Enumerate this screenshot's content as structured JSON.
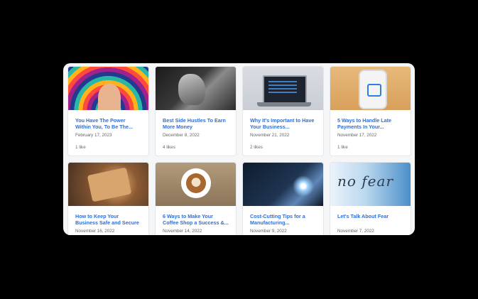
{
  "posts": [
    {
      "title": "You Have The Power Within You, To Be The...",
      "date": "February 17, 2023",
      "likes": "1 like",
      "image": "colorful-face-art"
    },
    {
      "title": "Best Side Hustles To Earn More Money",
      "date": "December 8, 2022",
      "likes": "4 likes",
      "image": "hand-bw"
    },
    {
      "title": "Why It's Important to Have Your Business...",
      "date": "November 21, 2022",
      "likes": "2 likes",
      "image": "laptop"
    },
    {
      "title": "5 Ways to Handle Late Payments In Your...",
      "date": "November 17, 2022",
      "likes": "1 like",
      "image": "payment-terminal"
    },
    {
      "title": "How to Keep Your Business Safe and Secure",
      "date": "November 16, 2022",
      "likes": "",
      "image": "team-table"
    },
    {
      "title": "6 Ways to Make Your Coffee Shop a Success &...",
      "date": "November 14, 2022",
      "likes": "",
      "image": "coffee-cup"
    },
    {
      "title": "Cost-Cutting Tips for a Manufacturing...",
      "date": "November 9, 2022",
      "likes": "",
      "image": "welding"
    },
    {
      "title": "Let's Talk About Fear",
      "date": "November 7, 2022",
      "likes": "",
      "image": "no-fear",
      "image_text": "no fear"
    }
  ],
  "colors": {
    "title": "#2f6fd6",
    "meta": "#666666",
    "panel": "#f5f6f8",
    "background": "#000000"
  }
}
